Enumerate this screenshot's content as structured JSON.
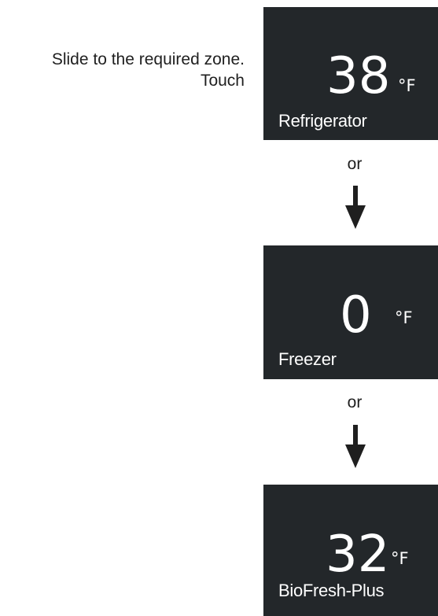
{
  "instruction": {
    "line1": "Slide to the required zone.",
    "line2": "Touch"
  },
  "panels": [
    {
      "temperature": "38",
      "unit": "°F",
      "zone": "Refrigerator"
    },
    {
      "temperature": "0",
      "unit": "°F",
      "zone": "Freezer"
    },
    {
      "temperature": "32",
      "unit": "°F",
      "zone": "BioFresh-Plus"
    }
  ],
  "connectors": [
    {
      "label": "or",
      "icon": "arrow-down-icon"
    },
    {
      "label": "or",
      "icon": "arrow-down-icon"
    }
  ],
  "colors": {
    "panel_background": "#23272a",
    "panel_text": "#ffffff",
    "page_text": "#1f1f1f"
  }
}
